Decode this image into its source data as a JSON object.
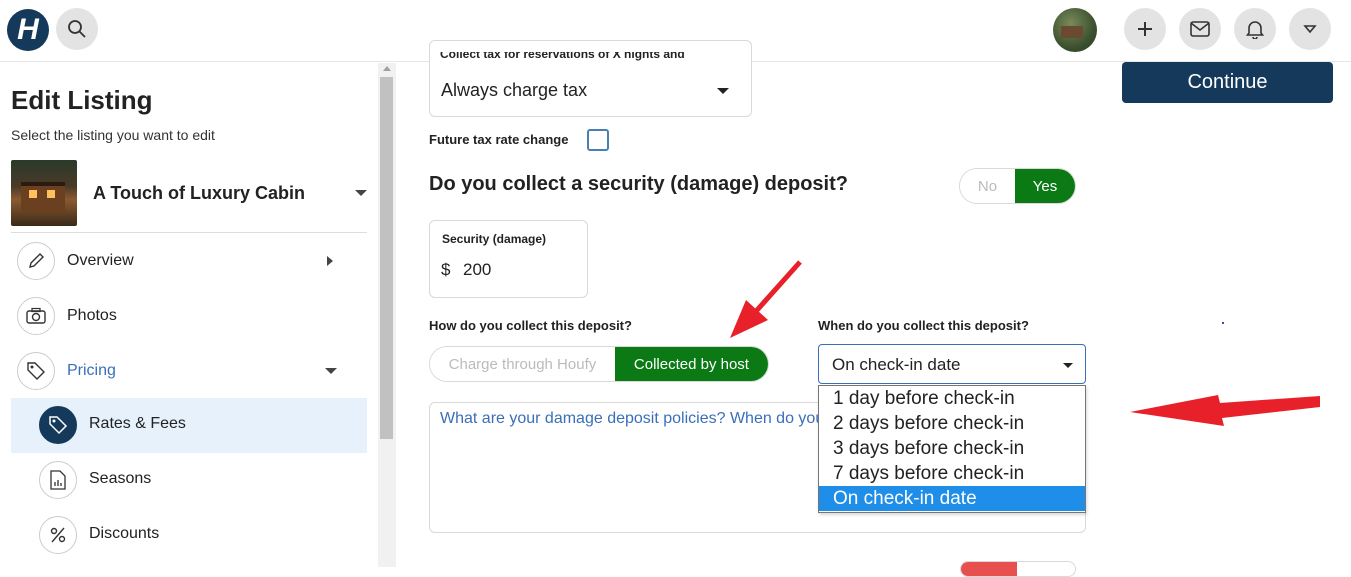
{
  "header": {
    "logo_letter": "H",
    "icons": [
      "search-icon",
      "plus-icon",
      "mail-icon",
      "bell-icon",
      "chevron-down-icon"
    ]
  },
  "sidebar": {
    "title": "Edit Listing",
    "subtitle": "Select the listing you want to edit",
    "listing_name": "A Touch of Luxury Cabin",
    "items": [
      {
        "label": "Overview",
        "icon": "pencil-icon"
      },
      {
        "label": "Photos",
        "icon": "camera-icon"
      },
      {
        "label": "Pricing",
        "icon": "tag-icon"
      }
    ],
    "subitems": [
      {
        "label": "Rates & Fees",
        "icon": "tag-icon"
      },
      {
        "label": "Seasons",
        "icon": "document-chart-icon"
      },
      {
        "label": "Discounts",
        "icon": "percent-icon"
      }
    ]
  },
  "main": {
    "tax_label_cut": "Collect tax for reservations of X nights and",
    "tax_select_value": "Always charge tax",
    "future_tax_label": "Future tax rate change",
    "deposit_question": "Do you collect a security (damage) deposit?",
    "deposit_toggle": {
      "no": "No",
      "yes": "Yes",
      "selected": "Yes"
    },
    "security_label": "Security (damage)",
    "currency": "$",
    "security_value": "200",
    "collect_how_label": "How do you collect this deposit?",
    "collect_how_options": {
      "a": "Charge through Houfy",
      "b": "Collected by host",
      "selected": "Collected by host"
    },
    "collect_when_label": "When do you collect this deposit?",
    "collect_when_value": "On check-in date",
    "collect_when_options": [
      "1 day before check-in",
      "2 days before check-in",
      "3 days before check-in",
      "7 days before check-in",
      "On check-in date"
    ],
    "collect_when_highlighted": "On check-in date",
    "policy_placeholder": "What are your damage deposit policies? When do you"
  },
  "continue_label": "Continue",
  "colors": {
    "navy": "#14395b",
    "green": "#0b7a14",
    "link_blue": "#3a6fb8",
    "highlight_blue": "#1e8ee8",
    "annotation_red": "#e8202a"
  }
}
